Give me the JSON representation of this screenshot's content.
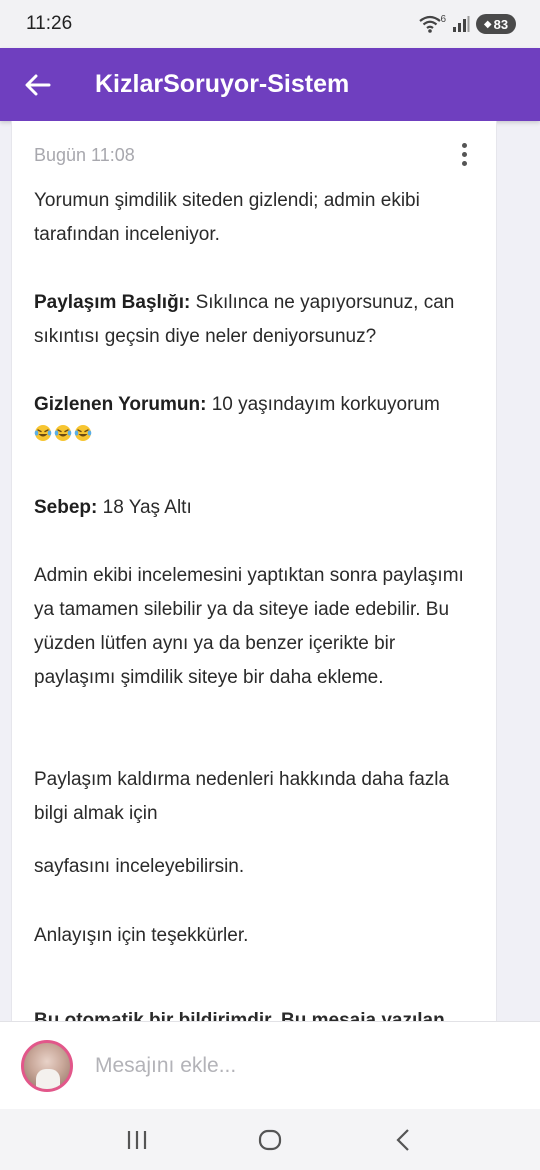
{
  "status_bar": {
    "time": "11:26",
    "battery": "83",
    "wifi_badge": "6"
  },
  "app_bar": {
    "title": "KizlarSoruyor-Sistem"
  },
  "message": {
    "date": "Bugün 11:08",
    "intro": "Yorumun şimdilik siteden gizlendi; admin ekibi tarafından inceleniyor.",
    "post_title_label": "Paylaşım Başlığı:",
    "post_title_value": " Sıkılınca ne yapıyorsunuz, can sıkıntısı geçsin diye neler deniyorsunuz?",
    "hidden_comment_label": "Gizlenen Yorumun:",
    "hidden_comment_value": " 10 yaşındayım korkuyorum",
    "hidden_comment_emojis": [
      "laughing-tears-emoji",
      "laughing-tears-emoji",
      "laughing-tears-emoji"
    ],
    "reason_label": "Sebep:",
    "reason_value": " 18 Yaş Altı",
    "review_note": "Admin ekibi incelemesini yaptıktan sonra paylaşımı ya tamamen silebilir ya da siteye iade edebilir. Bu yüzden lütfen aynı ya da benzer içerikte bir paylaşımı şimdilik siteye bir daha ekleme.",
    "info_text": "Paylaşım kaldırma nedenleri hakkında daha fazla bilgi almak için",
    "info_link_suffix": "sayfasını inceleyebilirsin.",
    "thanks": "Anlayışın için teşekkürler.",
    "auto_notice": "Bu otomatik bir bildirimdir. Bu mesaja yazılan"
  },
  "composer": {
    "placeholder": "Mesajını ekle...",
    "value": ""
  },
  "colors": {
    "app_bar": "#6f3fbf",
    "avatar_ring": "#e2578a",
    "background": "#f0f0f6"
  },
  "nav_bar": {
    "icons": [
      "recent-apps-icon",
      "home-icon",
      "back-icon"
    ]
  }
}
